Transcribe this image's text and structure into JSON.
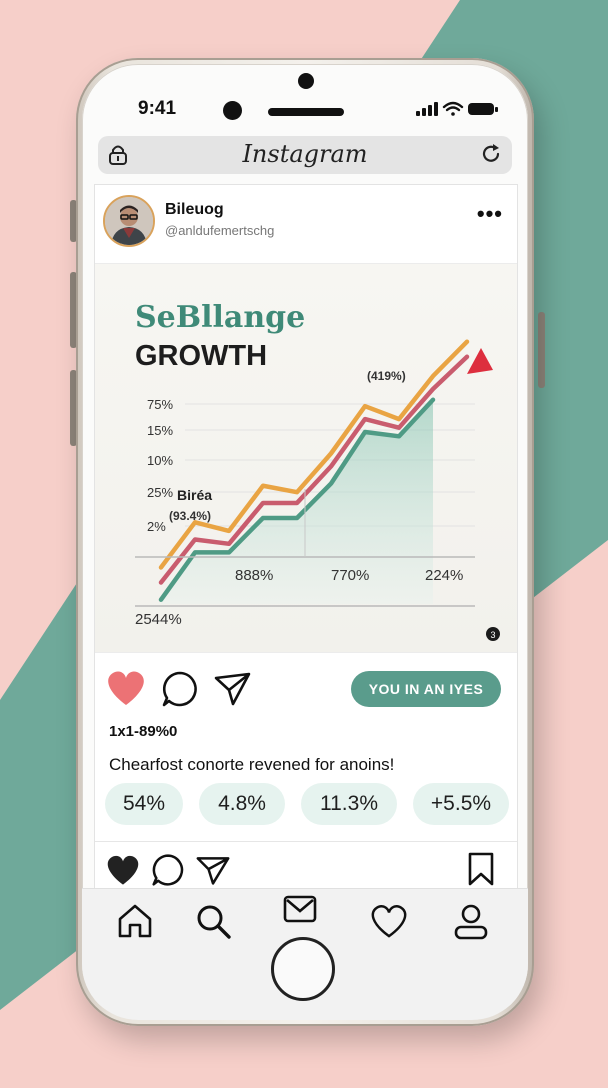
{
  "status_bar": {
    "time": "9:41"
  },
  "browser": {
    "title": "Instagram"
  },
  "post": {
    "username": "Bileuog",
    "handle": "@anldufemertschg",
    "more": "•••",
    "image": {
      "title_line1": "SeBllange",
      "title_line2": "GROWTH",
      "y_tick_labels": [
        "75%",
        "15%",
        "10%",
        "25%",
        "2%"
      ],
      "series_label": "Biréa",
      "annotation_left": "(93.4%)",
      "annotation_peak": "(419%)",
      "x_tick_labels": [
        "888%",
        "770%",
        "224%"
      ],
      "bottom_label": "2544%",
      "colors": {
        "green": "#4f9b85",
        "pink": "#c95c6e",
        "orange": "#e9a443",
        "arrow": "#dd2e3e"
      },
      "chart_data": {
        "type": "line",
        "series": [
          {
            "values": [
              2,
              24,
              24,
              40,
              40,
              56,
              80,
              78,
              95
            ]
          },
          {
            "values": [
              10,
              30,
              28,
              47,
              47,
              64,
              86,
              82,
              100,
              115
            ]
          },
          {
            "values": [
              17,
              38,
              34,
              55,
              52,
              70,
              92,
              86,
              106,
              122
            ]
          }
        ]
      }
    },
    "follow_button": "YOU IN AN IYES",
    "likes": "1x1-89%0",
    "caption": "Chearfost conorte revened for anoins!",
    "stats": [
      "54%",
      "4.8%",
      "11.3%",
      "+5.5%"
    ]
  },
  "icons": {
    "like": "heart-icon",
    "comment": "comment-icon",
    "share": "send-icon",
    "save": "bookmark-icon",
    "tabs": [
      "home-icon",
      "search-icon",
      "mail-icon",
      "heart-icon",
      "profile-icon"
    ]
  }
}
